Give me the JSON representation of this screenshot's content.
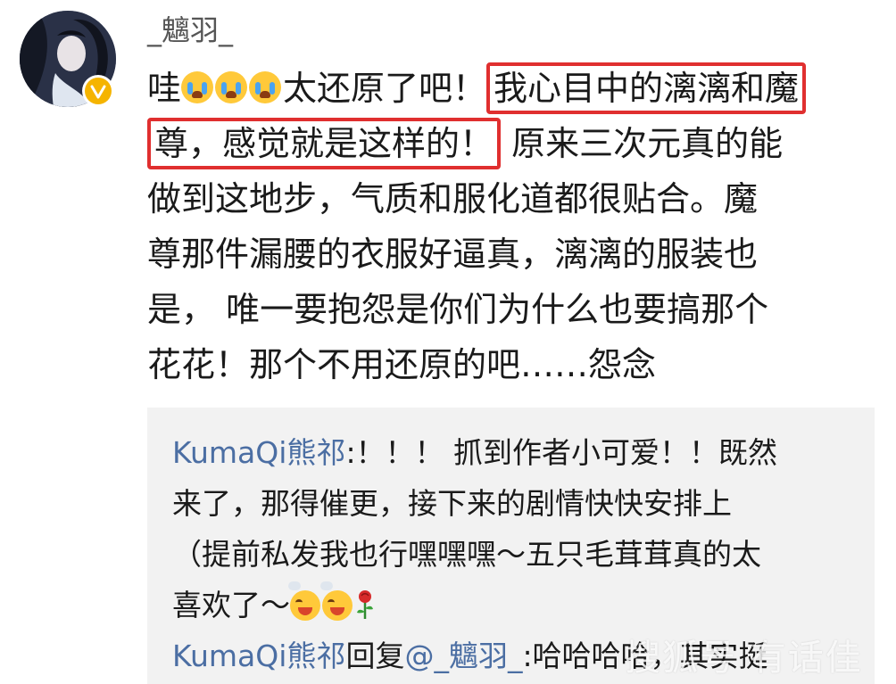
{
  "post": {
    "username": "_魑羽_",
    "comment_lines": [
      {
        "before": "哇",
        "emoji_count": 3,
        "text_a": "太还原了吧！",
        "highlight": "我心目中的漓漓和魔"
      },
      {
        "highlight": "尊，感觉就是这样的！",
        "after": " 原来三次元真的能"
      },
      {
        "text": "做到这地步，气质和服化道都很贴合。魔"
      },
      {
        "text": "尊那件漏腰的衣服好逼真，漓漓的服装也"
      },
      {
        "text": "是， 唯一要抱怨是你们为什么也要搞那个"
      },
      {
        "text": "花花！那个不用还原的吧……怨念"
      }
    ]
  },
  "replies": {
    "first": {
      "author": "KumaQi熊祁",
      "line1": ":！！！ 抓到作者小可爱！！既然",
      "line2": "来了，那得催更，接下来的剧情快快安排上",
      "line3": "（提前私发我也行嘿嘿嘿～五只毛茸茸真的太",
      "line4": "喜欢了～"
    },
    "second": {
      "author": "KumaQi熊祁",
      "reply_word": "回复",
      "mention": "@_魑羽_",
      "text": ":哈哈哈哈，其实挺"
    }
  },
  "icons": {
    "badge": "verified-badge-icon",
    "cry": "loudly-crying-emoji-icon",
    "happy": "grinning-emoji-icon",
    "rose": "rose-icon"
  },
  "colors": {
    "highlight_border": "#e02f2f",
    "link": "#4b6ea3",
    "reply_background": "#f2f2f2",
    "badge": "#f5b400"
  },
  "watermark": "搜狐号 有话佳"
}
